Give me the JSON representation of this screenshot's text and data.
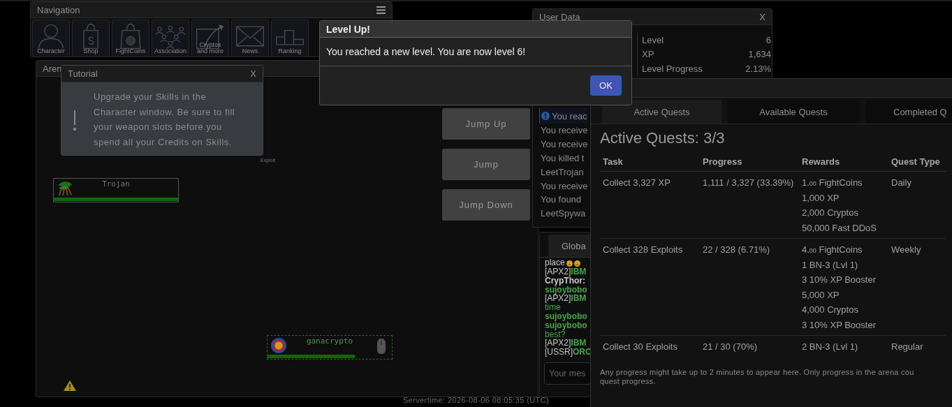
{
  "navigation": {
    "title": "Navigation",
    "items": [
      {
        "label": "Character",
        "kind": "person"
      },
      {
        "label": "Shop",
        "kind": "bag"
      },
      {
        "label": "FightCoins",
        "kind": "coinbag"
      },
      {
        "label": "Association",
        "kind": "group"
      },
      {
        "label": "Cryptos\nand more",
        "kind": "chart"
      },
      {
        "label": "News",
        "kind": "mail"
      },
      {
        "label": "Ranking",
        "kind": "podium"
      }
    ]
  },
  "arena": {
    "title": "Aren",
    "drop_label": "Exploit",
    "entities": [
      {
        "name": "Trojan",
        "kind": "npc",
        "level": 1.0
      },
      {
        "name": "ganacrypto",
        "kind": "player",
        "level": 0.7
      }
    ],
    "buttons": [
      "Jump Up",
      "Jump",
      "Jump Down"
    ]
  },
  "tutorial": {
    "title": "Tutorial",
    "close": "X",
    "text": "Upgrade your Skills in the Character window. Be sure to fill your weapon slots before you spend all your Credits on Skills."
  },
  "user_data": {
    "title": "User Data",
    "close": "X",
    "stats": [
      {
        "label": "Level",
        "value": "6"
      },
      {
        "label": "XP",
        "value": "1,634"
      },
      {
        "label": "Level Progress",
        "value": "2.13%"
      }
    ],
    "log": [
      {
        "text": "You reac",
        "kind": "info"
      },
      {
        "text": "You receive",
        "kind": "plain"
      },
      {
        "text": "You receive",
        "kind": "plain"
      },
      {
        "text": "You killed t",
        "kind": "plain"
      },
      {
        "text": "LeetTrojan",
        "kind": "plain"
      },
      {
        "text": "You receive",
        "kind": "plain"
      },
      {
        "text": "You found",
        "kind": "plain"
      },
      {
        "text": "LeetSpywa",
        "kind": "plain"
      }
    ]
  },
  "chat": {
    "tabs": [
      {
        "label": "Globa",
        "selected": true
      }
    ],
    "messages": [
      {
        "text": "place",
        "emoji": true,
        "color": "#cccccc"
      },
      {
        "tag": "[APX2]",
        "name": "IBM",
        "color": "#45a84a"
      },
      {
        "name": "CrypThor:",
        "color": "#cccccc"
      },
      {
        "name": "sujoybobo",
        "color": "#45a84a"
      },
      {
        "tag": "[APX2]",
        "name": "IBM",
        "color": "#45a84a"
      },
      {
        "text": "time",
        "color": "#45a84a"
      },
      {
        "name": "sujoybobo",
        "color": "#45a84a"
      },
      {
        "name": "sujoybobo",
        "color": "#45a84a"
      },
      {
        "text": "best?",
        "color": "#45a84a"
      },
      {
        "tag": "[APX2]",
        "name": "IBM",
        "color": "#45a84a"
      },
      {
        "tag": "[USSR]",
        "name": "ORC",
        "color": "#45a84a"
      }
    ],
    "placeholder": "Your mes"
  },
  "quests": {
    "tabs": [
      {
        "label": "Active Quests",
        "selected": true
      },
      {
        "label": "Available Quests",
        "selected": false
      },
      {
        "label": "Completed Q",
        "selected": false
      }
    ],
    "heading": "Active Quests: 3/3",
    "columns": [
      "Task",
      "Progress",
      "Rewards",
      "Quest Type"
    ],
    "rows": [
      {
        "task": "Collect 3,327 XP",
        "progress": "1,111 / 3,327 (33.39%)",
        "rewards": [
          "1.$_{00}$ FightCoins",
          "1,000 XP",
          "2,000 Cryptos",
          "50,000 Fast DDoS"
        ],
        "type": "Daily"
      },
      {
        "task": "Collect 328 Exploits",
        "progress": "22 / 328 (6.71%)",
        "rewards": [
          "4.$_{00}$ FightCoins",
          "1 BN-3 (Lvl 1)",
          "3 10% XP Booster",
          "5,000 XP",
          "4,000 Cryptos",
          "3 10% XP Booster"
        ],
        "type": "Weekly"
      },
      {
        "task": "Collect 30 Exploits",
        "progress": "21 / 30 (70%)",
        "rewards": [
          "2 BN-3 (Lvl 1)"
        ],
        "type": "Regular"
      }
    ],
    "note_lines": [
      "Any progress might take up to 2 minutes to appear here. Only progress in the arena cou",
      "quest progress."
    ]
  },
  "level_up": {
    "title": "Level Up!",
    "message": "You reached a new level. You are now level 6!",
    "button": "OK"
  },
  "servertime": "Servertime: 2026-08-06 08:05:35 (UTC)"
}
